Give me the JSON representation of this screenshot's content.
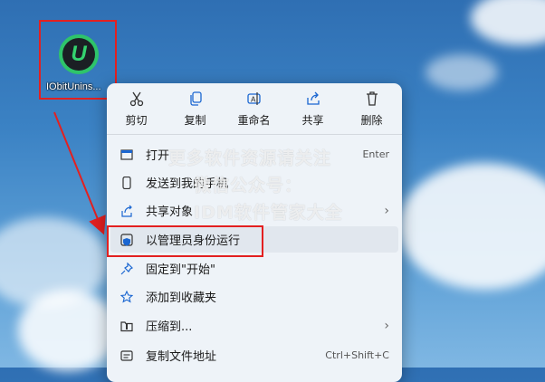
{
  "desktop": {
    "icon_label": "IObitUnins...",
    "icon_glyph": "U"
  },
  "toolbar": [
    {
      "label": "剪切",
      "icon": "scissors-icon"
    },
    {
      "label": "复制",
      "icon": "copy-icon"
    },
    {
      "label": "重命名",
      "icon": "rename-icon"
    },
    {
      "label": "共享",
      "icon": "share-icon"
    },
    {
      "label": "删除",
      "icon": "trash-icon"
    }
  ],
  "menu_items": [
    {
      "label": "打开",
      "shortcut": "Enter",
      "icon": "open-icon"
    },
    {
      "label": "发送到我的手机",
      "icon": "phone-icon"
    },
    {
      "label": "共享对象",
      "icon": "share-object-icon",
      "submenu": true
    },
    {
      "label": "以管理员身份运行",
      "icon": "shield-icon",
      "highlighted": true
    },
    {
      "label": "固定到\"开始\"",
      "icon": "pin-icon"
    },
    {
      "label": "添加到收藏夹",
      "icon": "star-icon"
    },
    {
      "label": "压缩到...",
      "icon": "folder-zip-icon",
      "submenu": true
    },
    {
      "label": "复制文件地址",
      "shortcut": "Ctrl+Shift+C",
      "icon": "copy-path-icon"
    }
  ],
  "submenu_arrow": "›",
  "watermark": {
    "line1": "更多软件资源请关注",
    "line2": "微信公众号：",
    "line3": "IDM软件管家大全"
  },
  "colors": {
    "annotation_red": "#e32020",
    "accent_blue": "#1a66d1"
  }
}
